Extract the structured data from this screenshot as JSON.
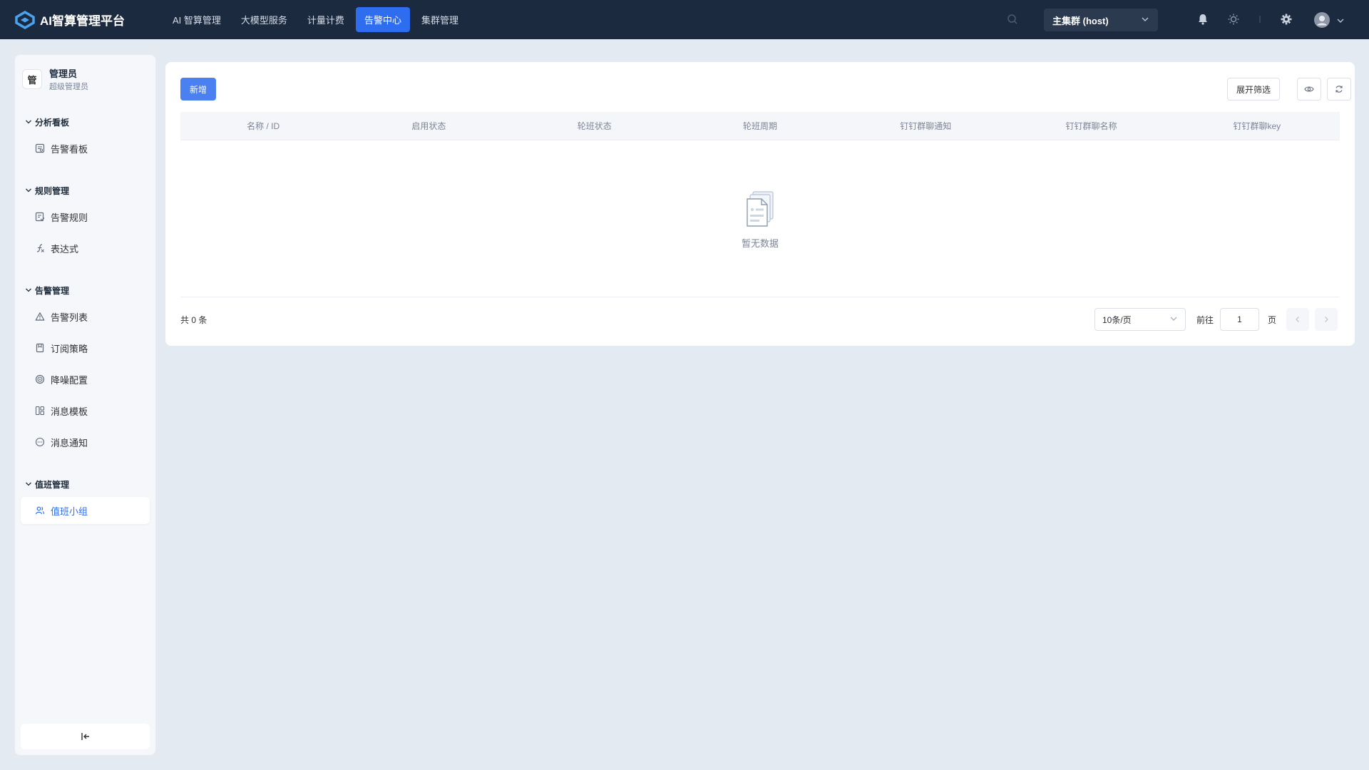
{
  "app": {
    "title": "AI智算管理平台"
  },
  "nav": [
    {
      "label": "AI 智算管理",
      "active": false
    },
    {
      "label": "大模型服务",
      "active": false
    },
    {
      "label": "计量计费",
      "active": false
    },
    {
      "label": "告警中心",
      "active": true
    },
    {
      "label": "集群管理",
      "active": false
    }
  ],
  "cluster": {
    "selected": "主集群 (host)"
  },
  "user": {
    "avatar_char": "管",
    "name": "管理员",
    "role": "超级管理员"
  },
  "sidebar": {
    "groups": [
      {
        "label": "分析看板",
        "items": [
          {
            "label": "告警看板",
            "icon": "dashboard-icon"
          }
        ]
      },
      {
        "label": "规则管理",
        "items": [
          {
            "label": "告警规则",
            "icon": "rule-icon"
          },
          {
            "label": "表达式",
            "icon": "expression-icon"
          }
        ]
      },
      {
        "label": "告警管理",
        "items": [
          {
            "label": "告警列表",
            "icon": "warning-icon"
          },
          {
            "label": "订阅策略",
            "icon": "subscribe-icon"
          },
          {
            "label": "降噪配置",
            "icon": "noise-icon"
          },
          {
            "label": "消息模板",
            "icon": "template-icon"
          },
          {
            "label": "消息通知",
            "icon": "message-icon"
          }
        ]
      },
      {
        "label": "值班管理",
        "items": [
          {
            "label": "值班小组",
            "icon": "team-icon",
            "active": true
          }
        ]
      }
    ],
    "collapse_icon": "collapse-icon"
  },
  "toolbar": {
    "add_label": "新增",
    "filter_label": "展开筛选"
  },
  "table": {
    "columns": [
      "名称 / ID",
      "启用状态",
      "轮班状态",
      "轮班周期",
      "钉钉群聊通知",
      "钉钉群聊名称",
      "钉钉群聊key"
    ],
    "rows": [],
    "empty_text": "暂无数据"
  },
  "pagination": {
    "total_label": "共 0 条",
    "page_size": "10条/页",
    "goto_label": "前往",
    "current_page": "1",
    "page_suffix": "页"
  },
  "colors": {
    "topbar": "#1c2a3f",
    "accent": "#2f6df0",
    "background": "#e4eaf2"
  }
}
